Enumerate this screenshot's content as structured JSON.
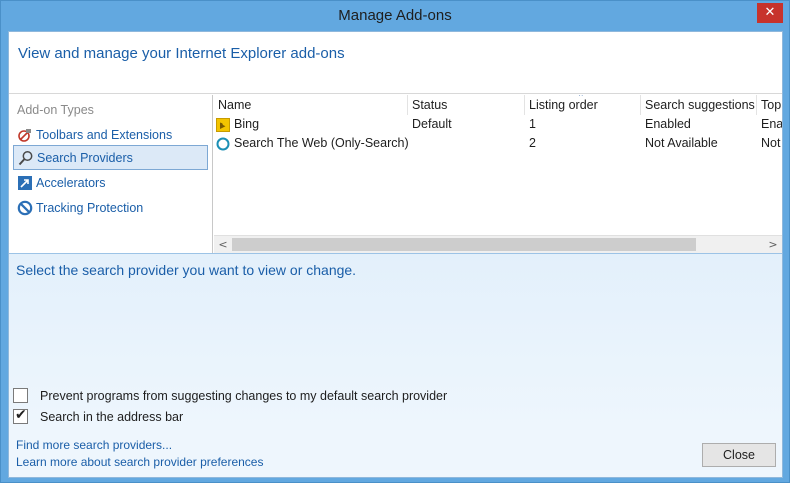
{
  "window": {
    "title": "Manage Add-ons",
    "close_glyph": "✕"
  },
  "header": {
    "text": "View and manage your Internet Explorer add-ons"
  },
  "sidebar": {
    "title": "Add-on Types",
    "items": [
      {
        "label": "Toolbars and Extensions",
        "icon": "toolbar-extension-icon"
      },
      {
        "label": "Search Providers",
        "icon": "search-icon",
        "selected": true
      },
      {
        "label": "Accelerators",
        "icon": "accelerator-icon"
      },
      {
        "label": "Tracking Protection",
        "icon": "tracking-protection-icon"
      }
    ]
  },
  "list": {
    "columns": [
      "Name",
      "Status",
      "Listing order",
      "Search suggestions",
      "Top"
    ],
    "sort_glyph": "^",
    "rows": [
      {
        "icon": "bing-icon",
        "name": "Bing",
        "status": "Default",
        "order": "1",
        "suggestions": "Enabled",
        "top": "Enab"
      },
      {
        "icon": "globe-icon",
        "name": "Search The Web (Only-Search)",
        "status": "",
        "order": "2",
        "suggestions": "Not Available",
        "top": "Not"
      }
    ],
    "scroll_left": "<",
    "scroll_right": ">"
  },
  "detail": {
    "text": "Select the search provider you want to view or change.",
    "checkboxes": [
      {
        "label": "Prevent programs from suggesting changes to my default search provider",
        "checked": false
      },
      {
        "label": "Search in the address bar",
        "checked": true,
        "check_glyph": "✔"
      }
    ]
  },
  "footer": {
    "links": [
      "Find more search providers...",
      "Learn more about search provider preferences"
    ],
    "close_label": "Close"
  },
  "colors": {
    "accent": "#1a5ea8",
    "titlebar": "#62a8e0",
    "close": "#c7332c",
    "selection": "#dce9f7"
  }
}
